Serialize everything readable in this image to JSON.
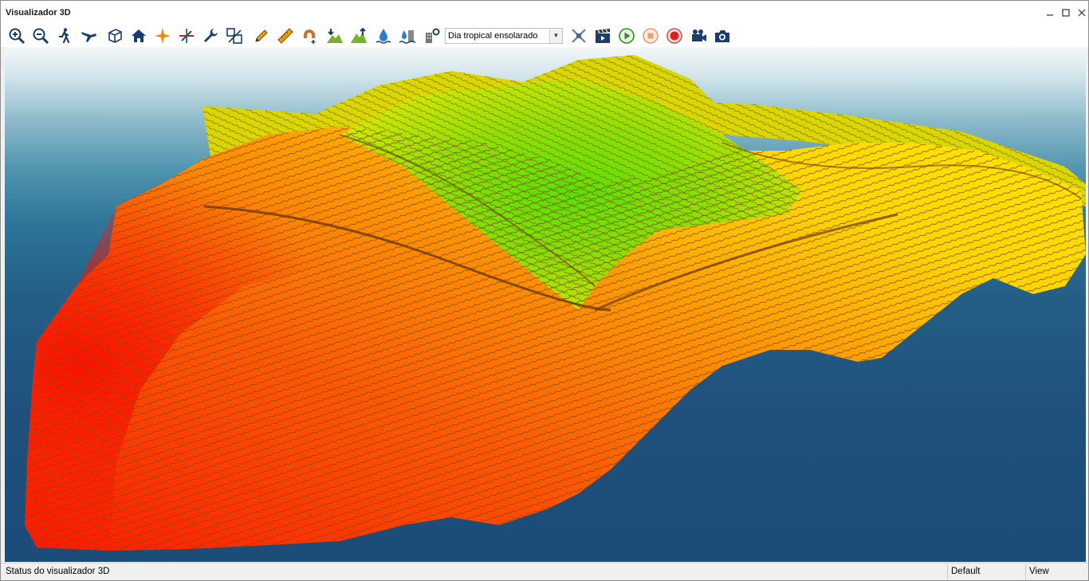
{
  "window": {
    "title": "Visualizador 3D"
  },
  "toolbar": {
    "buttons": [
      {
        "icon": "zoom-in-icon"
      },
      {
        "icon": "zoom-out-icon"
      },
      {
        "icon": "walk-icon"
      },
      {
        "icon": "fly-icon"
      },
      {
        "icon": "cube-icon"
      },
      {
        "icon": "home-icon"
      },
      {
        "icon": "star-center-icon"
      },
      {
        "icon": "axes-icon"
      },
      {
        "icon": "wrench-icon"
      },
      {
        "icon": "scale-icon"
      },
      {
        "icon": "pencil-icon"
      },
      {
        "icon": "ruler-icon"
      },
      {
        "icon": "magnet-icon"
      },
      {
        "icon": "terrain-lower-icon"
      },
      {
        "icon": "terrain-raise-icon"
      },
      {
        "icon": "water-level-icon"
      },
      {
        "icon": "water-building-icon"
      },
      {
        "icon": "building-settings-icon"
      }
    ],
    "weather_select": {
      "selected": "Dia tropical ensolarado"
    },
    "media_buttons": [
      {
        "icon": "satellite-icon"
      },
      {
        "icon": "clapperboard-icon"
      },
      {
        "icon": "play-icon"
      },
      {
        "icon": "stop-icon"
      },
      {
        "icon": "record-icon"
      },
      {
        "icon": "video-camera-icon"
      },
      {
        "icon": "photo-camera-icon"
      }
    ]
  },
  "status": {
    "message": "Status do visualizador 3D",
    "profile": "Default",
    "mode": "View"
  },
  "colors": {
    "terrain_low": "#ff1a00",
    "terrain_mid": "#ff9a00",
    "terrain_high": "#ffea00",
    "terrain_peak": "#5ae000",
    "water": "#1f517c",
    "contour": "#7a4a10"
  }
}
